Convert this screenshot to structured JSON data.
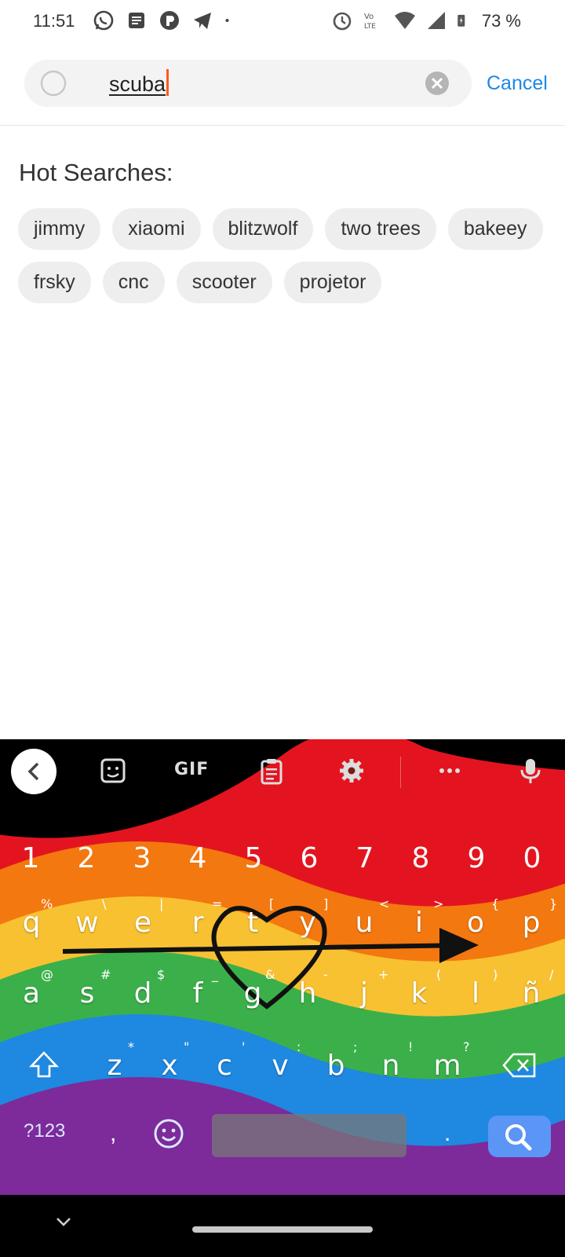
{
  "status_bar": {
    "time": "11:51",
    "battery": "73 %",
    "left_icons": [
      "whatsapp-icon",
      "message-icon",
      "app-icon",
      "telegram-icon",
      "dot-icon"
    ],
    "right_icons": [
      "alarm-icon",
      "volte-icon",
      "wifi-icon",
      "signal-icon",
      "battery-icon"
    ]
  },
  "search": {
    "query": "scuba",
    "cancel_label": "Cancel"
  },
  "hot_searches": {
    "title": "Hot Searches:",
    "rows": [
      [
        "jimmy",
        "xiaomi",
        "blitzwolf",
        "two trees",
        "bakeey"
      ],
      [
        "frsky",
        "cnc",
        "scooter",
        "projetor"
      ]
    ]
  },
  "keyboard": {
    "toolbar": {
      "gif_label": "GIF"
    },
    "numbers": [
      "1",
      "2",
      "3",
      "4",
      "5",
      "6",
      "7",
      "8",
      "9",
      "0"
    ],
    "row1": [
      {
        "k": "q",
        "h": "%"
      },
      {
        "k": "w",
        "h": "\\"
      },
      {
        "k": "e",
        "h": "|"
      },
      {
        "k": "r",
        "h": "="
      },
      {
        "k": "t",
        "h": "["
      },
      {
        "k": "y",
        "h": "]"
      },
      {
        "k": "u",
        "h": "<"
      },
      {
        "k": "i",
        "h": ">"
      },
      {
        "k": "o",
        "h": "{"
      },
      {
        "k": "p",
        "h": "}"
      }
    ],
    "row2": [
      {
        "k": "a",
        "h": "@"
      },
      {
        "k": "s",
        "h": "#"
      },
      {
        "k": "d",
        "h": "$"
      },
      {
        "k": "f",
        "h": "_"
      },
      {
        "k": "g",
        "h": "&"
      },
      {
        "k": "h",
        "h": "-"
      },
      {
        "k": "j",
        "h": "+"
      },
      {
        "k": "k",
        "h": "("
      },
      {
        "k": "l",
        "h": ")"
      },
      {
        "k": "ñ",
        "h": "/"
      }
    ],
    "row3": [
      {
        "k": "z",
        "h": "*"
      },
      {
        "k": "x",
        "h": "\""
      },
      {
        "k": "c",
        "h": "'"
      },
      {
        "k": "v",
        "h": ":"
      },
      {
        "k": "b",
        "h": ";"
      },
      {
        "k": "n",
        "h": "!"
      },
      {
        "k": "m",
        "h": "?"
      }
    ],
    "sym_label": "?123",
    "comma": ",",
    "period": "."
  },
  "colors": {
    "accent": "#1e88e5",
    "caret": "#ff5a1f",
    "chip_bg": "#eeeeee",
    "search_key": "#5b95f5"
  }
}
